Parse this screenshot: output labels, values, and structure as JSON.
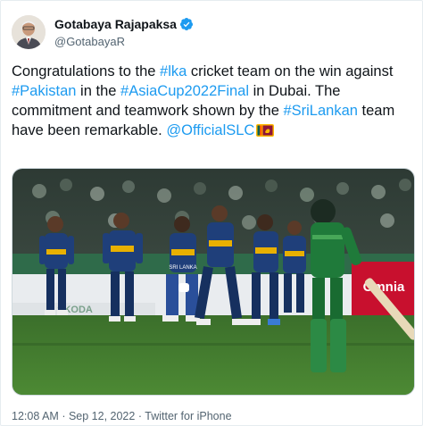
{
  "author": {
    "display_name": "Gotabaya Rajapaksa",
    "handle": "@GotabayaR",
    "verified": true
  },
  "tweet": {
    "segments": [
      {
        "text": "Congratulations to the ",
        "type": "text"
      },
      {
        "text": "#lka",
        "type": "link"
      },
      {
        "text": " cricket team on the win against ",
        "type": "text"
      },
      {
        "text": "#Pakistan",
        "type": "link"
      },
      {
        "text": " in the ",
        "type": "text"
      },
      {
        "text": "#AsiaCup2022Final",
        "type": "link"
      },
      {
        "text": " in Dubai. The commitment and teamwork shown by the ",
        "type": "text"
      },
      {
        "text": "#SriLankan",
        "type": "link"
      },
      {
        "text": " team have been remarkable. ",
        "type": "text"
      },
      {
        "text": "@OfficialSLC",
        "type": "link"
      }
    ],
    "flag_icon": "sri-lanka-flag-icon"
  },
  "media": {
    "banner_text_left": "SKODA",
    "banner_text_right": "Omnia",
    "jersey_text": "SRI LANKA"
  },
  "meta": {
    "time": "12:08 AM",
    "separator": "·",
    "date": "Sep 12, 2022",
    "source": "Twitter for iPhone"
  },
  "colors": {
    "link": "#1d9bf0",
    "verified": "#1d9bf0",
    "secondary_text": "#536471",
    "pitch_green": "#3e7a2e",
    "sl_jersey": "#1f3f7a",
    "pak_jersey": "#1f7a3a"
  }
}
